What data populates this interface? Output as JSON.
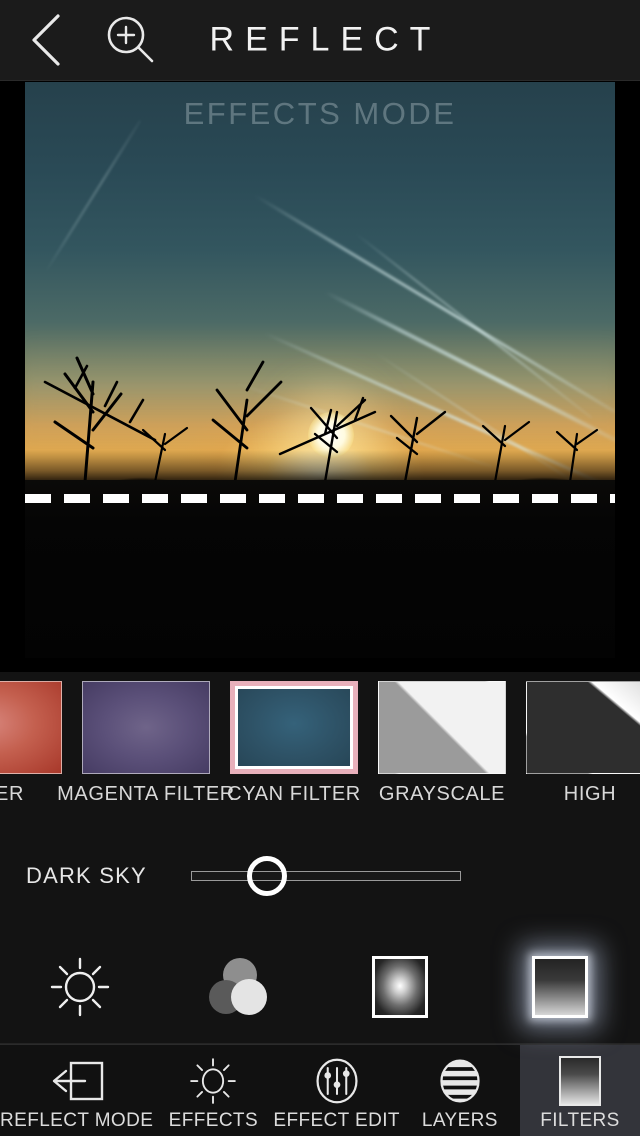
{
  "header": {
    "title": "REFLECT",
    "back_icon": "chevron-left-icon",
    "zoom_icon": "magnifier-plus-icon"
  },
  "canvas": {
    "mode_label": "EFFECTS MODE",
    "reflect_line": "dashed-reflect-axis",
    "photo_description": "sunset sky with contrails and silhouetted trees"
  },
  "filters": {
    "selected": "CYAN FILTER",
    "items": [
      {
        "label": "RED FILTER",
        "swatch": "th-red",
        "truncated": "LTER",
        "selected": false
      },
      {
        "label": "MAGENTA FILTER",
        "swatch": "th-mag",
        "truncated": "MAGENTA FILTER",
        "selected": false
      },
      {
        "label": "CYAN FILTER",
        "swatch": "th-cyan",
        "truncated": "CYAN FILTER",
        "selected": true
      },
      {
        "label": "GRAYSCALE",
        "swatch": "th-gray",
        "truncated": "GRAYSCALE",
        "selected": false
      },
      {
        "label": "HIGH CONTRAST",
        "swatch": "th-high",
        "truncated": "HIGH",
        "selected": false
      }
    ]
  },
  "slider": {
    "label": "DARK SKY",
    "value_percent": 28,
    "min": 0,
    "max": 100
  },
  "tools": [
    {
      "name": "brightness-tool",
      "icon": "sun-icon",
      "selected": false
    },
    {
      "name": "color-tool",
      "icon": "three-circles-icon",
      "selected": false
    },
    {
      "name": "glow-tool",
      "icon": "radial-glow-square-icon",
      "selected": false
    },
    {
      "name": "gradient-filter-tool",
      "icon": "gradient-square-icon",
      "selected": true
    }
  ],
  "tabs": [
    {
      "label": "REFLECT MODE",
      "icon": "arrow-out-of-box-icon",
      "active": false
    },
    {
      "label": "EFFECTS",
      "icon": "sun-icon",
      "active": false
    },
    {
      "label": "EFFECT EDIT",
      "icon": "sliders-circle-icon",
      "active": false
    },
    {
      "label": "LAYERS",
      "icon": "striped-circle-icon",
      "active": false
    },
    {
      "label": "FILTERS",
      "icon": "gradient-square-icon",
      "active": true
    }
  ],
  "colors": {
    "background": "#0d0d0d",
    "header_bg": "#1b1b1b",
    "panel_bg": "#131313",
    "selected_filter_border": "#e8b0bb",
    "active_tab_bg": "#33343a",
    "text": "#e6e6e6",
    "cyan_swatch": "#2e5266"
  }
}
